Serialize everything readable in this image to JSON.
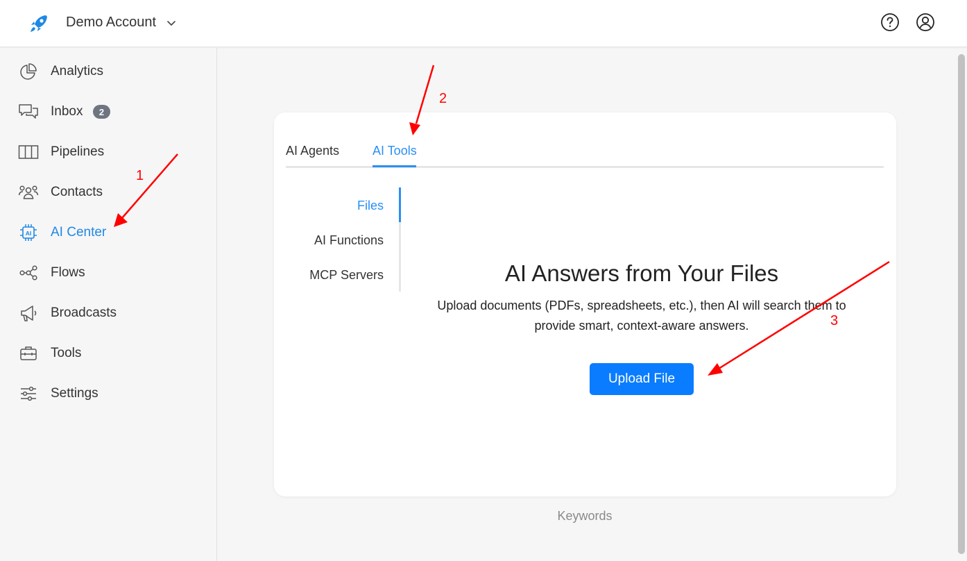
{
  "header": {
    "account_name": "Demo Account",
    "icons": [
      "rocket-logo-icon",
      "chevron-down-icon",
      "help-icon",
      "user-account-icon"
    ]
  },
  "sidebar": {
    "items": [
      {
        "label": "Analytics",
        "icon": "pie-chart-icon"
      },
      {
        "label": "Inbox",
        "icon": "chat-bubbles-icon",
        "badge": "2"
      },
      {
        "label": "Pipelines",
        "icon": "columns-icon"
      },
      {
        "label": "Contacts",
        "icon": "people-icon"
      },
      {
        "label": "AI Center",
        "icon": "ai-chip-icon",
        "active": true
      },
      {
        "label": "Flows",
        "icon": "flow-nodes-icon"
      },
      {
        "label": "Broadcasts",
        "icon": "megaphone-icon"
      },
      {
        "label": "Tools",
        "icon": "toolbox-icon"
      },
      {
        "label": "Settings",
        "icon": "sliders-icon"
      }
    ]
  },
  "main": {
    "tabs": [
      {
        "label": "AI Agents"
      },
      {
        "label": "AI Tools",
        "active": true
      }
    ],
    "subnav": [
      {
        "label": "Files",
        "active": true
      },
      {
        "label": "AI Functions"
      },
      {
        "label": "MCP Servers"
      }
    ],
    "headline": "AI Answers from Your Files",
    "description": "Upload documents (PDFs, spreadsheets, etc.), then AI will search them to provide smart, context-aware answers.",
    "upload_button": "Upload File",
    "footer_link": "Keywords"
  },
  "annotations": [
    "1",
    "2",
    "3"
  ],
  "colors": {
    "accent": "#2a8ff7",
    "button": "#0a7cff",
    "annotation": "#ff0000",
    "badge": "#6f7580"
  }
}
